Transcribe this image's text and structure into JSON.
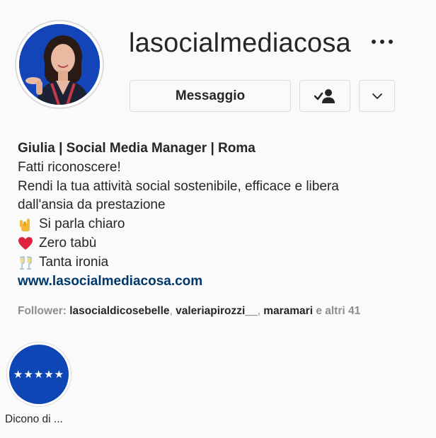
{
  "profile": {
    "username": "lasocialmediacosa",
    "full_name": "Giulia | Social Media Manager | Roma",
    "bio_lines": [
      "Fatti riconoscere!",
      "Rendi la tua attività social sostenibile, efficace e libera",
      "dall'ansia da prestazione"
    ],
    "bio_emoji_lines": [
      {
        "icon": "love-you-hand-emoji",
        "text": "Si parla chiaro"
      },
      {
        "icon": "red-heart-emoji",
        "text": "Zero tabù"
      },
      {
        "icon": "clinking-glasses-emoji",
        "text": "Tanta ironia"
      }
    ],
    "website": "www.lasocialmediacosa.com"
  },
  "actions": {
    "message_label": "Messaggio",
    "following_icon": "person-check-icon",
    "dropdown_icon": "chevron-down-icon",
    "more_icon": "more-options-icon"
  },
  "followers": {
    "prefix": "Follower:",
    "names": [
      "lasocialdicosebelle",
      "valeriapirozzi__",
      "maramari"
    ],
    "sep1": ", ",
    "sep2": ", ",
    "suffix": "e altri 41"
  },
  "highlights": [
    {
      "label": "Dicono di ...",
      "cover_text": "★★★★★"
    }
  ],
  "colors": {
    "avatar_bg": "#1445b8",
    "highlight_bg": "#0e47b5",
    "link": "#00376b",
    "border": "#dbdbdb",
    "muted": "#8e8e8e"
  }
}
